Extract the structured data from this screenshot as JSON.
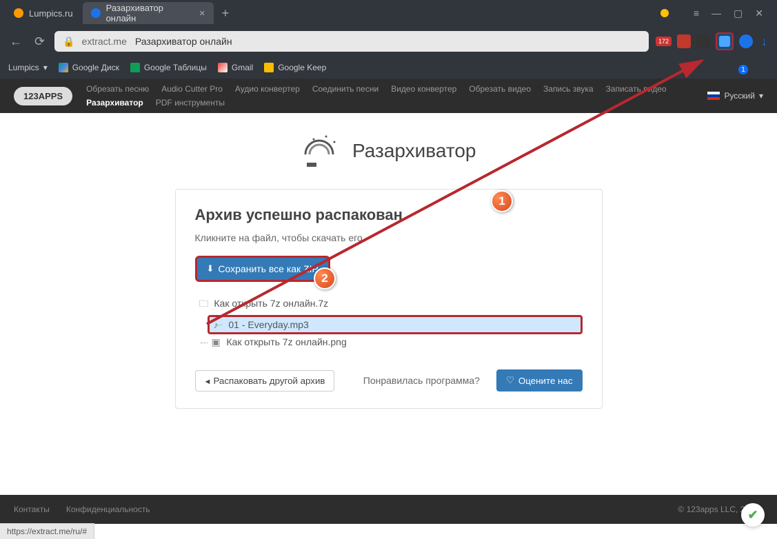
{
  "tabs": [
    {
      "label": "Lumpics.ru",
      "favicon_color": "#ff9800"
    },
    {
      "label": "Разархиватор онлайн",
      "favicon_color": "#1a73e8"
    }
  ],
  "address": {
    "domain": "extract.me",
    "title": "Разархиватор онлайн"
  },
  "ext_badge": "172",
  "notif_count": "1",
  "bookmarks": [
    "Lumpics",
    "Google Диск",
    "Google Таблицы",
    "Gmail",
    "Google Keep"
  ],
  "site_nav": {
    "logo": "123APPS",
    "links": [
      "Обрезать песню",
      "Audio Cutter Pro",
      "Аудио конвертер",
      "Соединить песни",
      "Видео конвертер",
      "Обрезать видео",
      "Запись звука",
      "Записать видео",
      "Разархиватор",
      "PDF инструменты"
    ],
    "active_index": 8,
    "lang": "Русский"
  },
  "hero": {
    "title": "Разархиватор"
  },
  "panel": {
    "heading": "Архив успешно распакован",
    "sub": "Кликните на файл, чтобы скачать его.",
    "save_btn": "Сохранить все как ZIP",
    "tree": {
      "root": "Как открыть 7z онлайн.7z",
      "items": [
        "01 - Everyday.mp3",
        "Как открыть 7z онлайн.png"
      ],
      "selected_index": 0
    },
    "unpack_another": "Распаковать другой архив",
    "liked": "Понравилась программа?",
    "rate": "Оцените нас"
  },
  "footer": {
    "contacts": "Контакты",
    "privacy": "Конфиденциальность",
    "copy": "© 123apps LLC, 2012–"
  },
  "status_url": "https://extract.me/ru/#",
  "callouts": {
    "c1": "1",
    "c2": "2"
  }
}
